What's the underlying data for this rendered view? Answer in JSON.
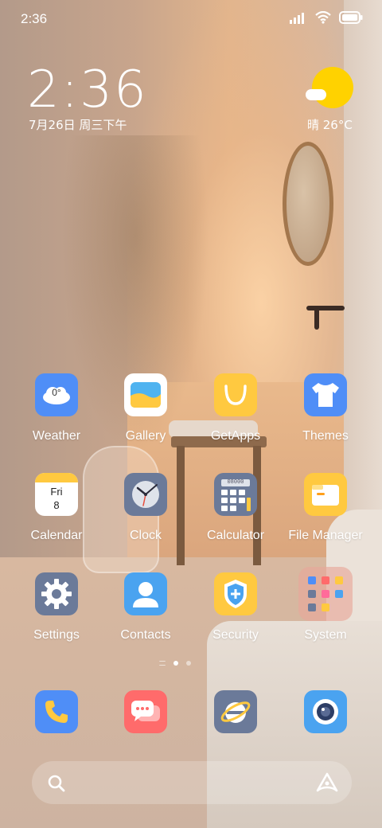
{
  "status_bar": {
    "time": "2:36",
    "icons": [
      "signal-icon",
      "wifi-icon",
      "battery-icon"
    ]
  },
  "clock_widget": {
    "time": "2:36",
    "date": "7月26日 周三下午"
  },
  "weather_widget": {
    "condition_temp": "晴 26°C",
    "icon": "sun-cloud-icon"
  },
  "apps": [
    {
      "label": "Weather",
      "icon": "weather-icon",
      "color": "#4f8ef7",
      "badge_text": "0°"
    },
    {
      "label": "Gallery",
      "icon": "gallery-icon",
      "color": "#ffffff"
    },
    {
      "label": "GetApps",
      "icon": "getapps-icon",
      "color": "#ffc940"
    },
    {
      "label": "Themes",
      "icon": "themes-icon",
      "color": "#4f8ef7"
    },
    {
      "label": "Calendar",
      "icon": "calendar-icon",
      "color": "#ffffff",
      "day_name": "Fri",
      "day_num": "8"
    },
    {
      "label": "Clock",
      "icon": "clock-icon",
      "color": "#6b7a99"
    },
    {
      "label": "Calculator",
      "icon": "calculator-icon",
      "color": "#6b7a99",
      "display": "08000"
    },
    {
      "label": "File Manager",
      "icon": "file-manager-icon",
      "color": "#ffc940"
    },
    {
      "label": "Settings",
      "icon": "settings-icon",
      "color": "#6b7a99"
    },
    {
      "label": "Contacts",
      "icon": "contacts-icon",
      "color": "#4aa3f0"
    },
    {
      "label": "Security",
      "icon": "security-icon",
      "color": "#ffc940"
    },
    {
      "label": "System",
      "icon": "folder-icon",
      "color": "#e8a79a"
    }
  ],
  "page_indicator": {
    "pages": 2,
    "active": 1
  },
  "dock": [
    {
      "icon": "phone-icon",
      "color": "#4f8ef7"
    },
    {
      "icon": "messages-icon",
      "color": "#ff6b6b"
    },
    {
      "icon": "browser-icon",
      "color": "#6b7a99"
    },
    {
      "icon": "camera-icon",
      "color": "#4aa3f0"
    }
  ],
  "search_bar": {
    "search_icon": "search-icon",
    "assistant_icon": "assistant-icon"
  }
}
